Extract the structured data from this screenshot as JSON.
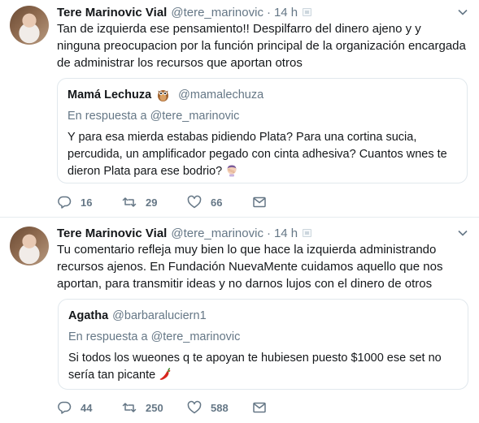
{
  "tweets": [
    {
      "author_name": "Tere Marinovic Vial",
      "author_handle": "@tere_marinovic",
      "separator": "·",
      "time": "14 h",
      "text": "Tan de izquierda ese pensamiento!! Despilfarro del dinero ajeno y y ninguna preocupacion por la función principal de la organización encargada de administrar los recursos que aportan otros",
      "quoted": {
        "author_name": "Mamá Lechuza",
        "author_icon": "owl-emoji",
        "author_handle": "@mamalechuza",
        "reply_to": "En respuesta a @tere_marinovic",
        "text": "Y para esa mierda estabas pidiendo Plata? Para una cortina sucia, percudida, un amplificador pegado con cinta adhesiva? Cuantos wnes te dieron Plata para ese bodrio?",
        "trailing_emoji": "woman-facepalming-emoji"
      },
      "stats": {
        "replies": "16",
        "retweets": "29",
        "likes": "66"
      }
    },
    {
      "author_name": "Tere Marinovic Vial",
      "author_handle": "@tere_marinovic",
      "separator": "·",
      "time": "14 h",
      "text": "Tu comentario refleja muy bien lo que hace la izquierda administrando recursos ajenos. En Fundación NuevaMente cuidamos aquello que nos aportan, para transmitir ideas y no darnos lujos con el dinero de otros",
      "quoted": {
        "author_name": "Agatha",
        "author_handle": "@barbaraluciern1",
        "reply_to": "En respuesta a @tere_marinovic",
        "text": "Si todos los wueones q te apoyan te hubiesen puesto $1000 ese set no sería tan picante",
        "trailing_emoji": "hot-pepper-emoji"
      },
      "stats": {
        "replies": "44",
        "retweets": "250",
        "likes": "588"
      }
    }
  ],
  "colors": {
    "text": "#14171a",
    "secondary": "#657786",
    "border": "#e1e8ed",
    "divider": "#e6ecf0"
  }
}
